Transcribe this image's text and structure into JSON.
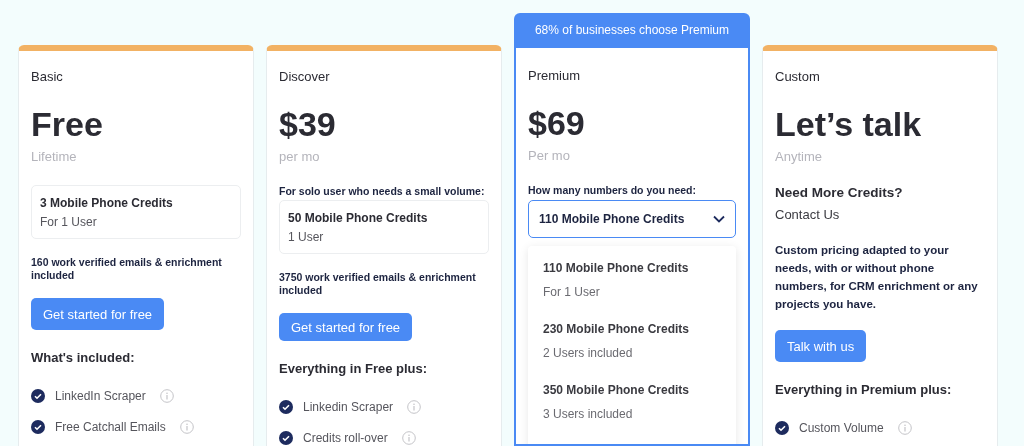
{
  "plans": [
    {
      "name": "Basic",
      "price": "Free",
      "period": "Lifetime",
      "credit_box": {
        "title": "3 Mobile Phone Credits",
        "subtitle": "For 1 User"
      },
      "emails": "160 work verified emails & enrichment included",
      "button": "Get started for free",
      "features_heading": "What's included:",
      "features": [
        {
          "label": "LinkedIn Scraper"
        },
        {
          "label": "Free Catchall Emails"
        }
      ]
    },
    {
      "name": "Discover",
      "price": "$39",
      "period": "per mo",
      "note": "For solo user who needs a small volume:",
      "credit_box": {
        "title": "50 Mobile Phone Credits",
        "subtitle": "1 User"
      },
      "emails": "3750 work verified emails & enrichment included",
      "button": "Get started for free",
      "features_heading": "Everything in Free plus:",
      "features": [
        {
          "label": "Linkedin Scraper"
        },
        {
          "label": "Credits roll-over"
        }
      ]
    },
    {
      "badge": "68% of businesses choose Premium",
      "name": "Premium",
      "price": "$69",
      "period": "Per mo",
      "note": "How many numbers do you need:",
      "dropdown": {
        "value": "110 Mobile Phone Credits",
        "expanded": true,
        "options": [
          {
            "title": "110 Mobile Phone Credits",
            "subtitle": "For 1 User"
          },
          {
            "title": "230 Mobile Phone Credits",
            "subtitle": "2 Users included"
          },
          {
            "title": "350 Mobile Phone Credits",
            "subtitle": "3 Users included"
          }
        ]
      }
    },
    {
      "name": "Custom",
      "price": "Let’s talk",
      "period": "Anytime",
      "contact_heading": "Need More Credits?",
      "contact_link": "Contact Us",
      "description": "Custom pricing adapted to your needs, with or without phone numbers, for CRM enrichment or any projects you have.",
      "button": "Talk with us",
      "features_heading": "Everything in Premium plus:",
      "features": [
        {
          "label": "Custom Volume"
        }
      ]
    }
  ]
}
